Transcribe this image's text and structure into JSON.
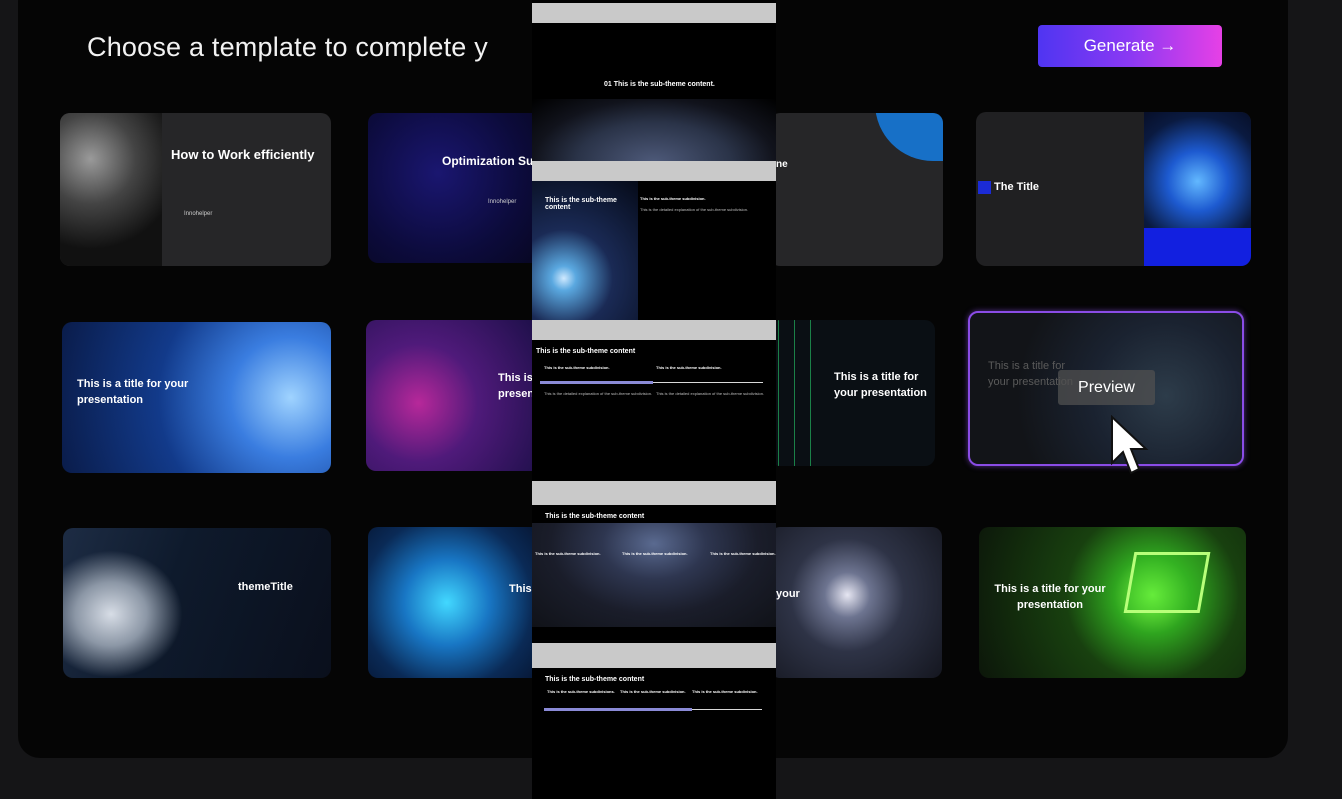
{
  "header": {
    "title": "Choose a template to complete y",
    "generate_label": "Generate →"
  },
  "templates": {
    "c1_title": "How to Work efficiently",
    "c1_sub": "Innohelper",
    "c2_title": "Optimization Su",
    "c2_sub": "Innohelper",
    "c3_title": "ne",
    "c4_title": "This is a title for your presentation",
    "c5_title": "This is presen",
    "c6_title": "This is a title for your presentation",
    "c7_title": "themeTitle",
    "c8_title": "This",
    "c9_title": "your",
    "c10_title": "The Title",
    "c11_title": "This is a title for your presentation",
    "c11_preview": "Preview",
    "c12_title": "This is a title for your presentation"
  },
  "overlay": {
    "s1_title": "01 This is the sub-theme content.",
    "s2_title": "This is the sub-theme content",
    "s2_sub": "This is the sub-theme subdivision.",
    "s2_text": "This is the detailed explanation of the sub-theme subdivision.",
    "s3_title": "This is the sub-theme content",
    "s3_col1": "This is the sub-theme subdivision.",
    "s3_col2": "This is the sub-theme subdivision.",
    "s3_text1": "This is the detailed explanation of the sub-theme subdivision.",
    "s3_text2": "This is the detailed explanation of the sub-theme subdivision.",
    "s4_title": "This is the sub-theme content",
    "s4_col1": "This is the sub-theme subdivision.",
    "s4_col2": "This is the sub-theme subdivision.",
    "s4_col3": "This is the sub-theme subdivision.",
    "s5_title": "This is the sub-theme content",
    "s5_col1": "This is the sub-theme subdivisions.",
    "s5_col2": "This is the sub-theme subdivision.",
    "s5_col3": "This is the sub-theme subdivision."
  }
}
